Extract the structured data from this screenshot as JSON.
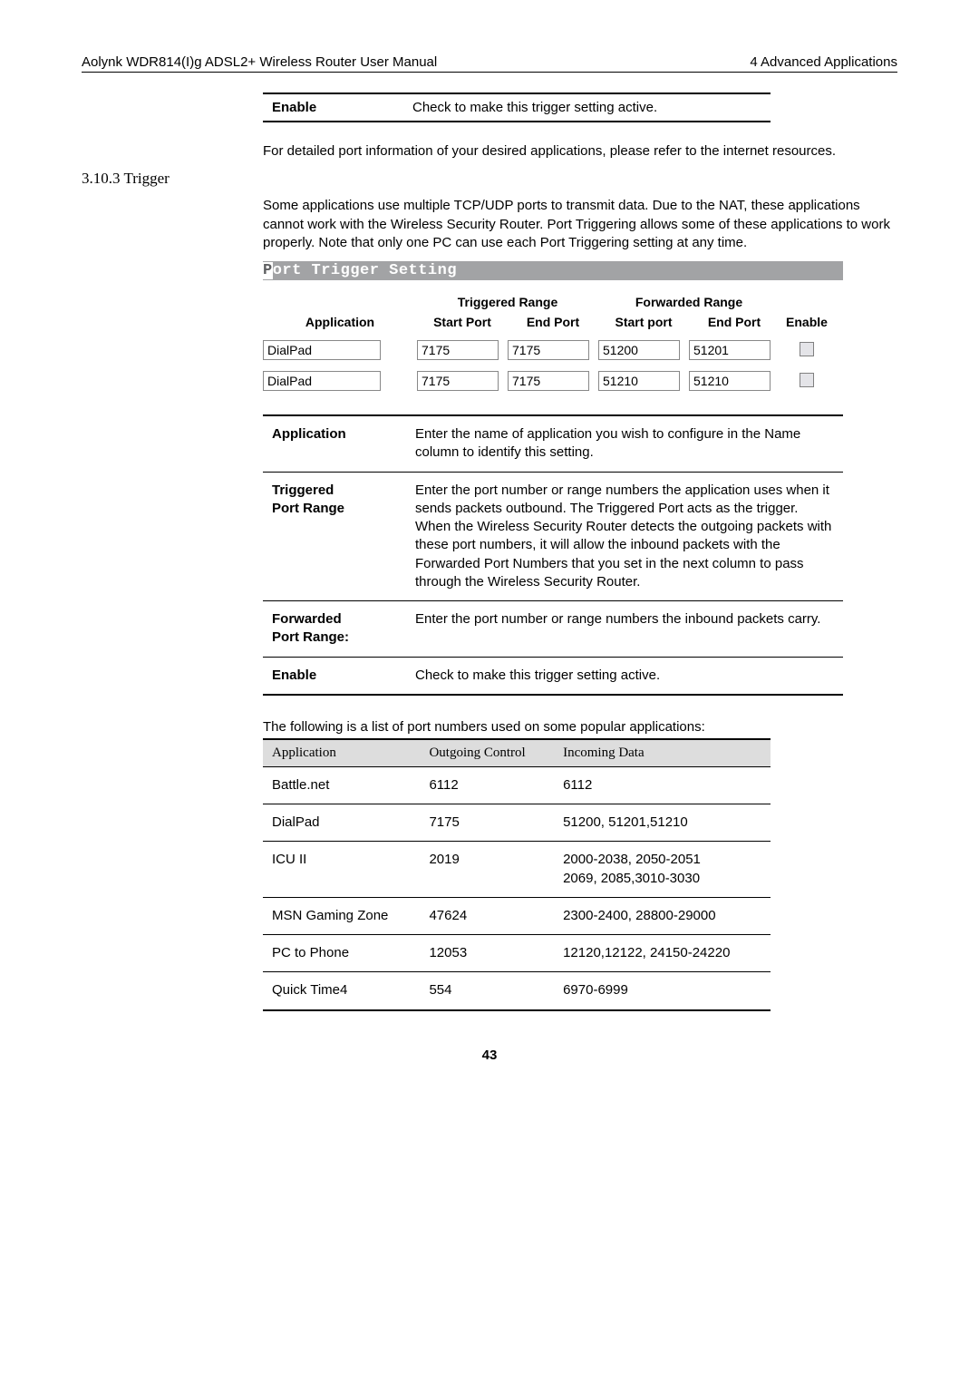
{
  "header": {
    "left": "Aolynk WDR814(I)g ADSL2+ Wireless Router User Manual",
    "right": "4 Advanced Applications"
  },
  "def1": {
    "label": "Enable",
    "text": "Check to make this trigger setting active."
  },
  "para1": "For detailed port information of your desired applications, please refer to the internet resources.",
  "section_num": "3.10.3  Trigger",
  "para2": "Some applications use multiple TCP/UDP ports to transmit data. Due to the NAT, these applications cannot work with the Wireless Security Router. Port Triggering allows some of these applications to work properly. Note that only one PC can use each Port Triggering setting at any time.",
  "port_trigger_bar": {
    "pre": "P",
    "rest": "ort Trigger Setting"
  },
  "pt_headers": {
    "application": "Application",
    "triggered": "Triggered Range",
    "forwarded": "Forwarded Range",
    "start_port": "Start Port",
    "end_port": "End Port",
    "start_port2": "Start port",
    "end_port2": "End Port",
    "enable": "Enable"
  },
  "pt_rows": [
    {
      "app": "DialPad",
      "t_start": "7175",
      "t_end": "7175",
      "f_start": "51200",
      "f_end": "51201"
    },
    {
      "app": "DialPad",
      "t_start": "7175",
      "t_end": "7175",
      "f_start": "51210",
      "f_end": "51210"
    }
  ],
  "defs": [
    {
      "label": "Application",
      "text": "Enter the name of application you wish to configure in the Name column to identify this setting."
    },
    {
      "label": "Triggered Port Range",
      "text": "Enter the port number or range numbers the application uses when it sends packets outbound. The Triggered Port acts as the trigger. When the Wireless Security Router detects the outgoing packets with these port numbers, it will allow the inbound packets with the Forwarded Port Numbers that you set in the next column to pass through the Wireless Security Router."
    },
    {
      "label": "Forwarded Port Range:",
      "text": "Enter the port number or range numbers the inbound packets carry."
    },
    {
      "label": "Enable",
      "text": "Check to make this trigger setting active."
    }
  ],
  "apps_caption": "The following is a list of port numbers used on some popular applications:",
  "apps_headers": {
    "c1": "Application",
    "c2": "Outgoing Control",
    "c3": "Incoming Data"
  },
  "apps_rows": [
    {
      "c1": "Battle.net",
      "c2": "6112",
      "c3": "6112"
    },
    {
      "c1": "DialPad",
      "c2": "7175",
      "c3": "51200, 51201,51210"
    },
    {
      "c1": "ICU II",
      "c2": "2019",
      "c3": "2000-2038, 2050-2051\n2069, 2085,3010-3030"
    },
    {
      "c1": "MSN Gaming Zone",
      "c2": "47624",
      "c3": "2300-2400, 28800-29000"
    },
    {
      "c1": "PC to Phone",
      "c2": "12053",
      "c3": "12120,12122, 24150-24220"
    },
    {
      "c1": "Quick Time4",
      "c2": "554",
      "c3": "6970-6999"
    }
  ],
  "page_num": "43"
}
